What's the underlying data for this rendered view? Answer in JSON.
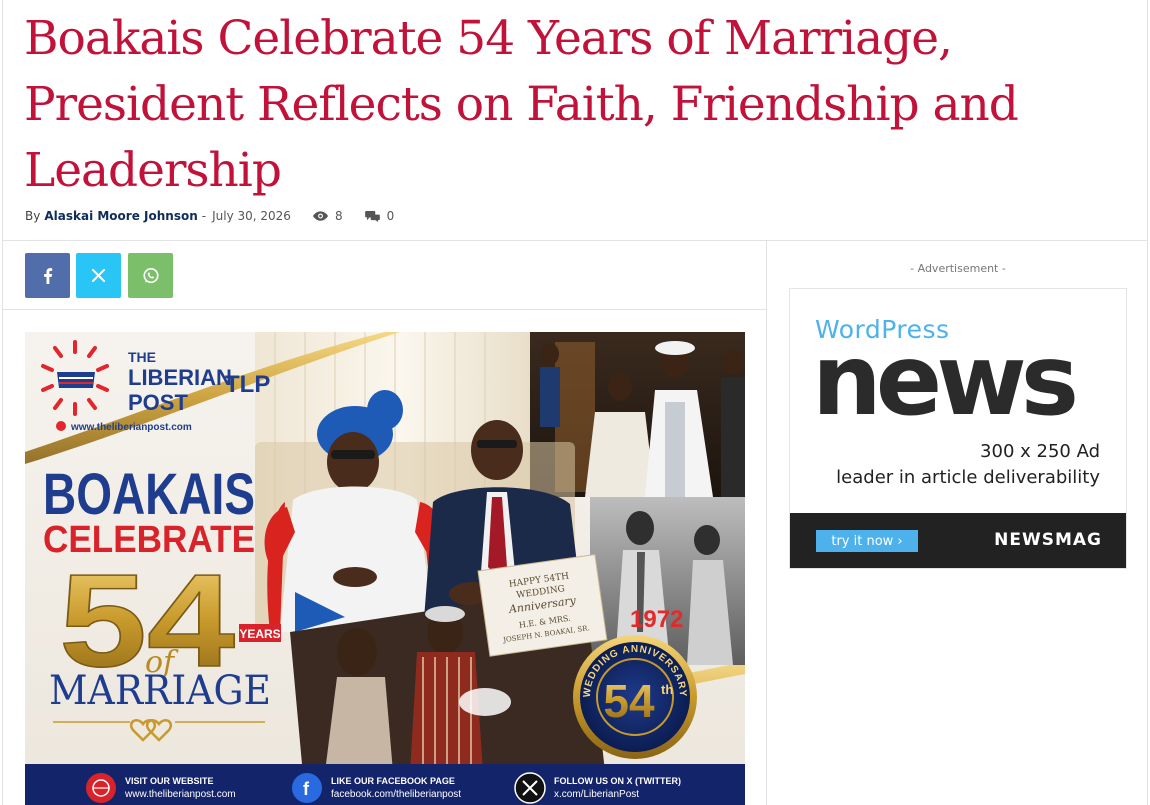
{
  "article": {
    "title": "Boakais Celebrate 54 Years of Marriage, President Reflects on Faith, Friendship and Leadership",
    "by_label": "By",
    "author": "Alaskai Moore Johnson",
    "separator": "-",
    "date": "July 30, 2026",
    "views": "8",
    "comments": "0"
  },
  "share": {
    "facebook_icon": "facebook-icon",
    "x_icon": "x-icon",
    "whatsapp_icon": "whatsapp-icon"
  },
  "feature_image": {
    "logo_line1": "THE",
    "logo_line2": "LIBERIAN",
    "logo_line3": "POST",
    "logo_mark": "TLP",
    "website": "www.theliberianpost.com",
    "headline_1": "BOAKAIS",
    "headline_2": "CELEBRATE",
    "number": "54",
    "years_label": "YEARS",
    "of_label": "of",
    "marriage_label": "MARRIAGE",
    "card_text_1": "HAPPY 54TH",
    "card_text_2": "WEDDING",
    "card_text_3": "Anniversary",
    "card_text_4": "H.E. & MRS.",
    "card_text_5": "JOSEPH N. BOAKAI, SR.",
    "year_1972": "1972",
    "badge_ring": "WEDDING ANNIVERSARY",
    "badge_number": "54",
    "badge_suffix": "th",
    "footer_1_title": "VISIT OUR WEBSITE",
    "footer_1_sub": "www.theliberianpost.com",
    "footer_2_title": "LIKE OUR FACEBOOK PAGE",
    "footer_2_sub": "facebook.com/theliberianpost",
    "footer_3_title": "FOLLOW US ON X (TWITTER)",
    "footer_3_sub": "x.com/LiberianPost"
  },
  "advertisement": {
    "label": "- Advertisement -",
    "brand_top": "WordPress",
    "brand_main": "news",
    "size_text": "300 x 250 Ad",
    "tagline": "leader in article deliverability",
    "cta": "try it now ›",
    "footer_brand": "NEWSMAG"
  },
  "colors": {
    "headline": "#c1123a",
    "author": "#0f2c5a",
    "facebook": "#516eab",
    "x": "#29c5f6",
    "whatsapp": "#7bbf6a",
    "ad_accent": "#4db2ec"
  }
}
